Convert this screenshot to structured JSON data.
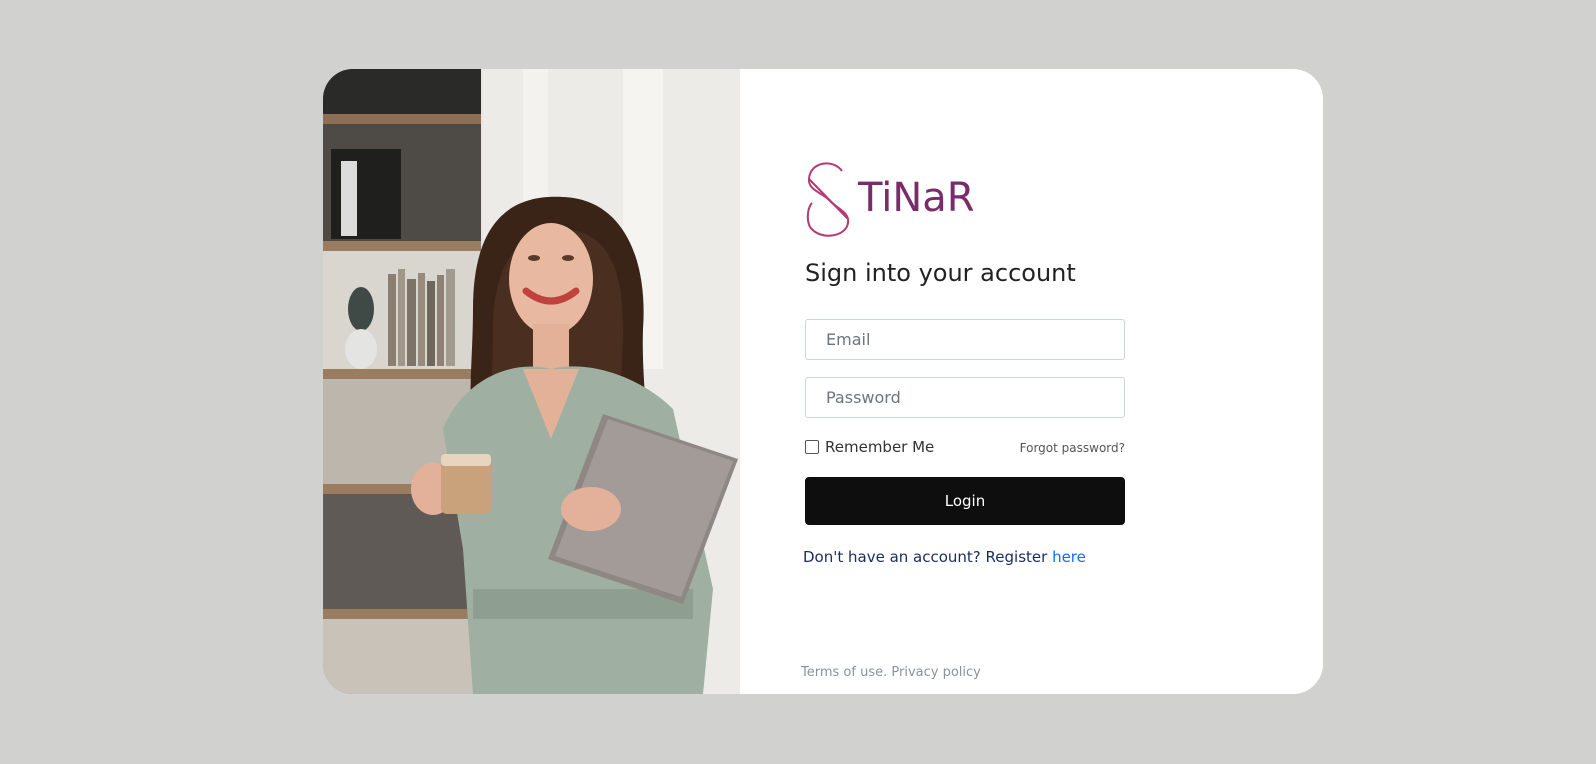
{
  "brand": {
    "name": "TiNaR",
    "color": "#7a2c6a",
    "logo_icon": "s-monogram-icon"
  },
  "form": {
    "heading": "Sign into your account",
    "email_placeholder": "Email",
    "password_placeholder": "Password",
    "remember_label": "Remember Me",
    "forgot_label": "Forgot password?",
    "login_label": "Login",
    "register_prefix": "Don't have an account? Register ",
    "register_link": "here"
  },
  "footer": {
    "terms": "Terms of use.",
    "privacy": "Privacy policy"
  },
  "colors": {
    "page_background": "#d1d1cf",
    "button_background": "#0e0e0e",
    "link": "#0d6efd"
  }
}
